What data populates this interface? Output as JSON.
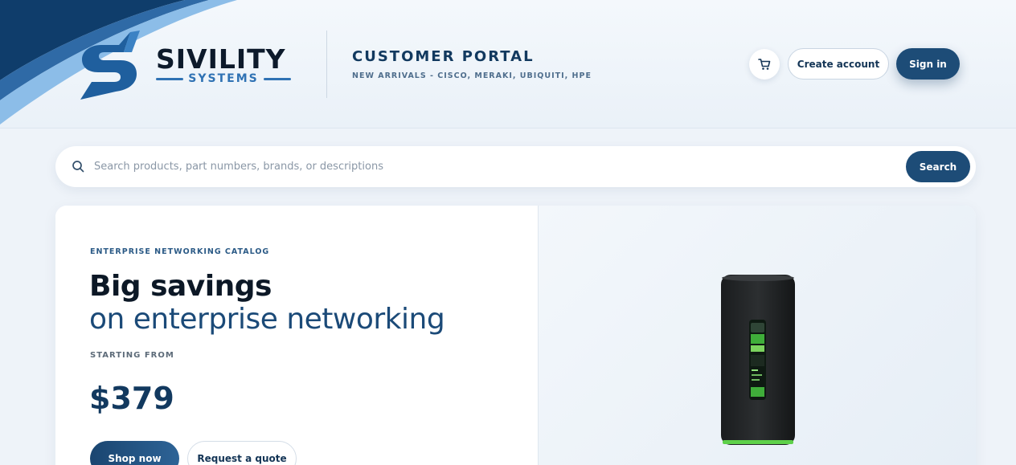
{
  "brand": {
    "name": "SIVILITY",
    "subname": "SYSTEMS"
  },
  "header": {
    "portal_title": "CUSTOMER PORTAL",
    "portal_subtitle": "NEW ARRIVALS - CISCO, MERAKI, UBIQUITI, HPE",
    "cart_icon": "cart-icon",
    "create_account_label": "Create account",
    "sign_in_label": "Sign in"
  },
  "search": {
    "placeholder": "Search products, part numbers, brands, or descriptions",
    "value": "",
    "button_label": "Search",
    "icon": "search-icon"
  },
  "hero": {
    "kicker": "ENTERPRISE NETWORKING CATALOG",
    "headline": "Big savings",
    "subheadline": "on enterprise networking",
    "starting_label": "STARTING FROM",
    "price": "$379",
    "primary_cta": "Shop now",
    "secondary_cta": "Request a quote"
  },
  "colors": {
    "brand_navy": "#12395f",
    "button_primary": "#1d4c77",
    "accent_blue": "#2f72b4",
    "page_bg": "#eef3f9"
  }
}
